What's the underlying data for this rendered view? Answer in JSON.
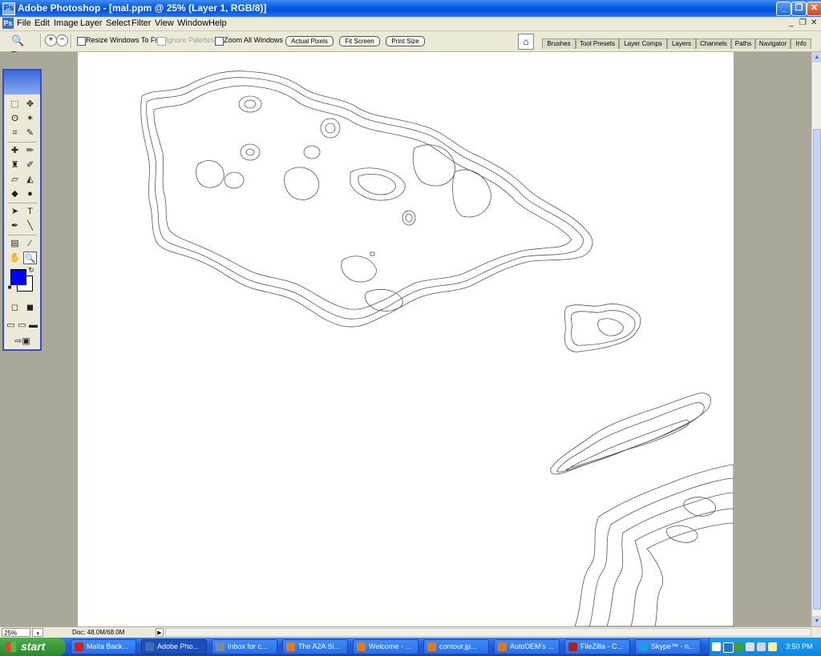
{
  "window": {
    "title": "Adobe Photoshop - [mal.ppm @ 25% (Layer 1, RGB/8)]",
    "min_label": "_",
    "max_label": "❐",
    "close_label": "✕"
  },
  "menu": {
    "items": [
      "File",
      "Edit",
      "Image",
      "Layer",
      "Select",
      "Filter",
      "View",
      "Window",
      "Help"
    ],
    "doc_min": "_",
    "doc_restore": "❐",
    "doc_close": "✕"
  },
  "options": {
    "resize_windows": "Resize Windows To Fit",
    "ignore_palettes": "Ignore Palettes",
    "zoom_all": "Zoom All Windows",
    "actual_pixels": "Actual Pixels",
    "fit_screen": "Fit Screen",
    "print_size": "Print Size"
  },
  "palette_well": {
    "tabs": [
      "Brushes",
      "Tool Presets",
      "Layer Comps",
      "Layers",
      "Channels",
      "Paths",
      "Navigator",
      "Info"
    ]
  },
  "tools": {
    "foreground_color": "#0000ff",
    "background_color": "#ffffff"
  },
  "status": {
    "zoom": "25%",
    "doc": "Doc: 48.0M/68.0M"
  },
  "taskbar": {
    "start": "start",
    "items": [
      {
        "label": "Malta Back...",
        "icon_color": "#d02020"
      },
      {
        "label": "Adobe Pho...",
        "icon_color": "#3d6fb8"
      },
      {
        "label": "Inbox for c...",
        "icon_color": "#7a8aa0"
      },
      {
        "label": "The A2A Si...",
        "icon_color": "#e07a20"
      },
      {
        "label": "Welcome - ...",
        "icon_color": "#e07a20"
      },
      {
        "label": "contour.jp...",
        "icon_color": "#e07a20"
      },
      {
        "label": "AutoDEM's ...",
        "icon_color": "#e07a20"
      },
      {
        "label": "FileZilla - C...",
        "icon_color": "#b02020"
      },
      {
        "label": "Skype™ - n...",
        "icon_color": "#1aa0e0"
      }
    ],
    "clock": "3:50 PM"
  }
}
